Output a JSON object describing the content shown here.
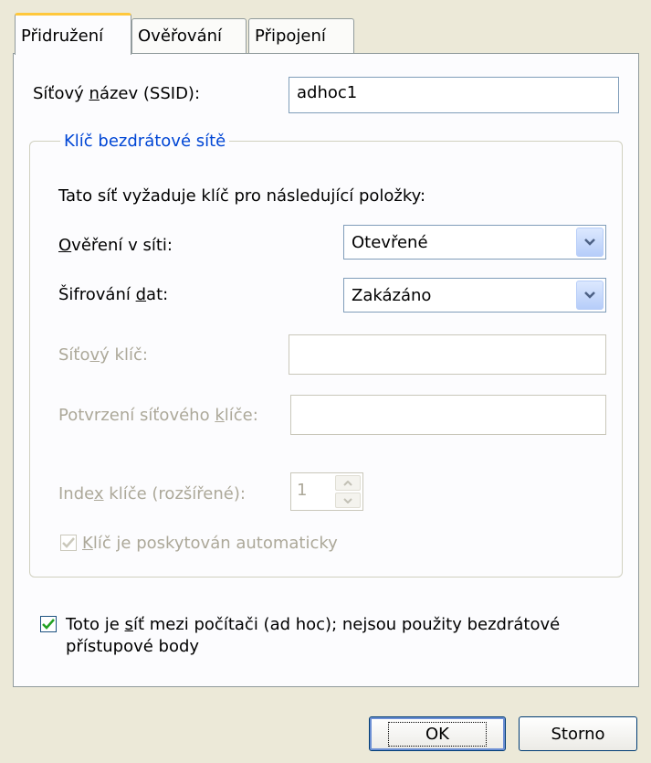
{
  "tabs": [
    {
      "label": "Přidružení",
      "active": true
    },
    {
      "label": "Ověřování",
      "active": false
    },
    {
      "label": "Připojení",
      "active": false
    }
  ],
  "ssid": {
    "label_pre": "Síťový ",
    "label_ul": "n",
    "label_post": "ázev (SSID):",
    "value": "adhoc1"
  },
  "wireless_key": {
    "group_title": "Klíč bezdrátové sítě",
    "intro": "Tato síť vyžaduje klíč pro následující položky:",
    "auth": {
      "label_ul": "O",
      "label_post": "věření v síti:",
      "value": "Otevřené"
    },
    "encryption": {
      "label_pre": "Šifrování ",
      "label_ul": "d",
      "label_post": "at:",
      "value": "Zakázáno"
    },
    "network_key": {
      "label_pre": "Síťo",
      "label_ul": "v",
      "label_post": "ý klíč:",
      "value": ""
    },
    "confirm_key": {
      "label_pre": "Potvrzení síťového ",
      "label_ul": "k",
      "label_post": "líče:",
      "value": ""
    },
    "key_index": {
      "label_pre": "Inde",
      "label_ul": "x",
      "label_post": " klíče (rozšířené):",
      "value": "1"
    },
    "auto_key": {
      "label_ul": "K",
      "label_post": "líč je poskytován automaticky",
      "checked": true
    }
  },
  "adhoc": {
    "label_pre": "Toto je ",
    "label_ul": "s",
    "label_post": "íť mezi počítači (ad hoc); nejsou použity bezdrátové",
    "label_line2": "přístupové body",
    "checked": true
  },
  "buttons": {
    "ok": "OK",
    "cancel": "Storno"
  },
  "colors": {
    "accent_tab": "#FFC83C",
    "group_title": "#0046D5",
    "check_mark": "#21A121",
    "disabled_text": "#ACA899"
  }
}
